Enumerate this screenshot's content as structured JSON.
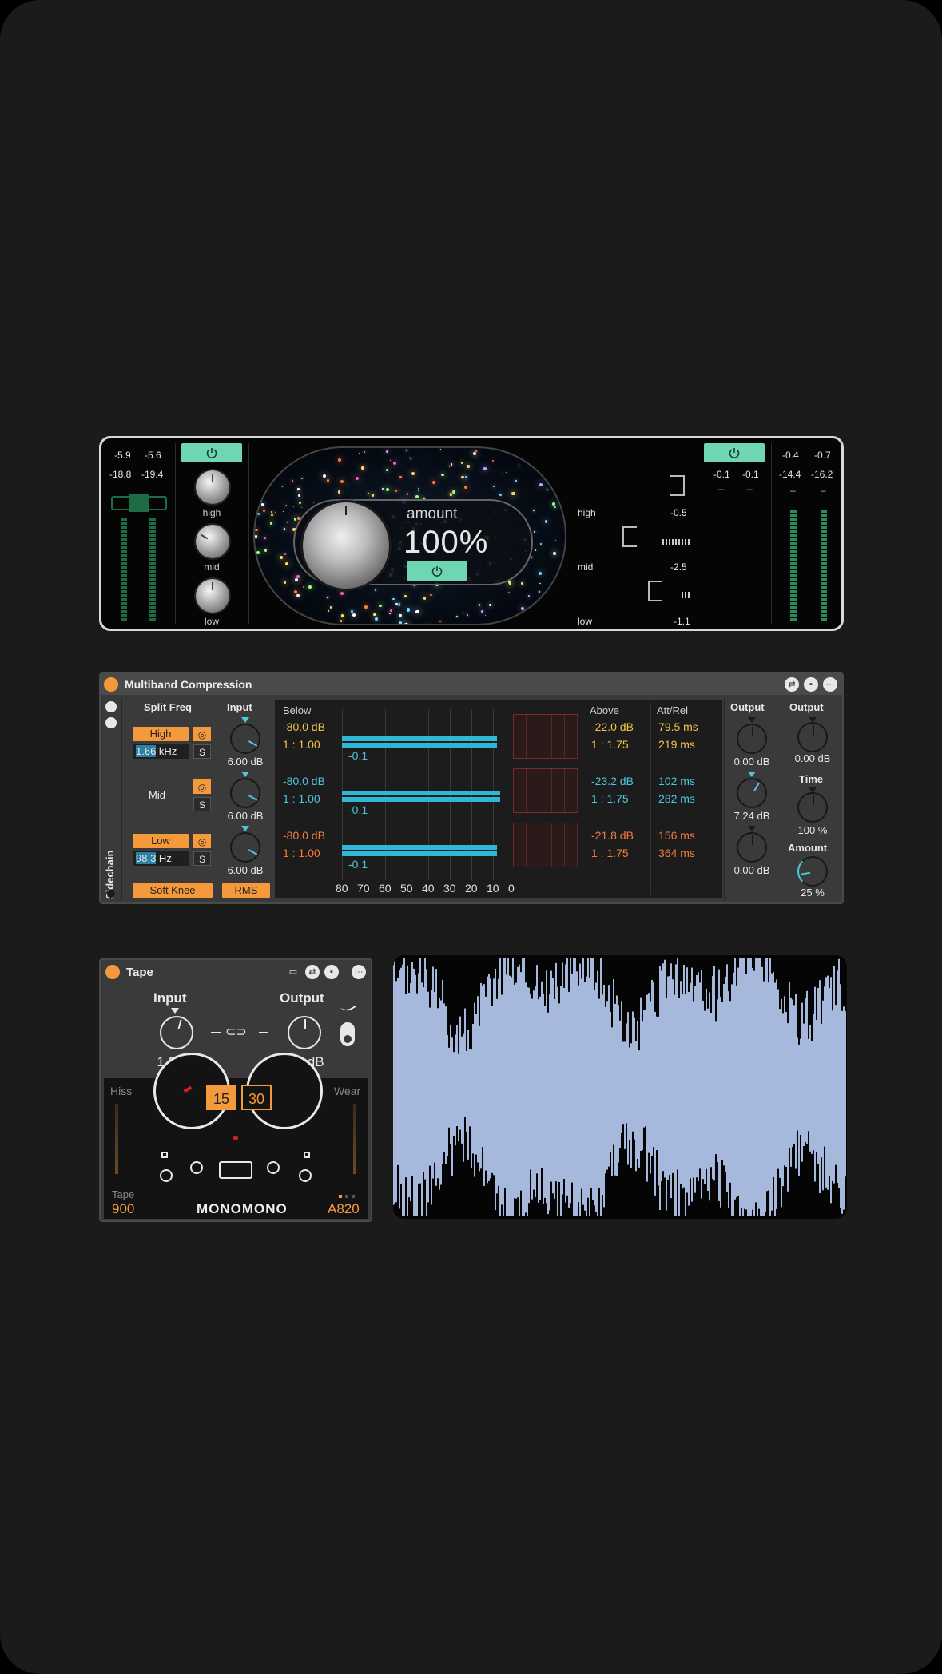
{
  "device1": {
    "left_meter": {
      "peak_l": "-5.9",
      "peak_r": "-5.6",
      "rms_l": "-18.8",
      "rms_r": "-19.4"
    },
    "right_meter": {
      "peak_l": "-0.4",
      "peak_r": "-0.7",
      "rms_l": "-14.4",
      "rms_r": "-16.2"
    },
    "bands": [
      {
        "label": "high"
      },
      {
        "label": "mid"
      },
      {
        "label": "low"
      }
    ],
    "amount_label": "amount",
    "amount_value": "100%",
    "gain_labels": {
      "high": "high",
      "mid": "mid",
      "low": "low"
    },
    "gain_values": {
      "high": "-0.5",
      "mid": "-2.5",
      "low": "-1.1"
    },
    "out_values": {
      "a": "-0.1",
      "b": "-0.1"
    },
    "dash": "–",
    "accent": "#6fd6b3"
  },
  "multiband": {
    "title": "Multiband Compression",
    "split_freq_label": "Split Freq",
    "input_label": "Input",
    "below_label": "Below",
    "above_label": "Above",
    "att_rel_label": "Att/Rel",
    "output_label": "Output",
    "output2_label": "Output",
    "time_label": "Time",
    "amount_label": "Amount",
    "sidechain_label": "Sidechain",
    "high_btn": "High",
    "low_btn": "Low",
    "mid_label": "Mid",
    "solo": "S",
    "high_freq_hl": "1.66",
    "high_freq_unit": " kHz",
    "low_freq_hl": "98.3",
    "low_freq_unit": " Hz",
    "soft_knee": "Soft Knee",
    "rms": "RMS",
    "input_gains": [
      "6.00 dB",
      "6.00 dB",
      "6.00 dB"
    ],
    "output_gains": [
      "0.00 dB",
      "7.24 dB",
      "0.00 dB"
    ],
    "global_output": "0.00 dB",
    "time_value": "100 %",
    "amount_value": "25 %",
    "rows": [
      {
        "below_thr": "-80.0 dB",
        "below_ratio": "1 : 1.00",
        "gr": "-0.1",
        "above_thr": "-22.0 dB",
        "above_ratio": "1 : 1.75",
        "attack": "79.5 ms",
        "release": "219 ms"
      },
      {
        "below_thr": "-80.0 dB",
        "below_ratio": "1 : 1.00",
        "gr": "-0.1",
        "above_thr": "-23.2 dB",
        "above_ratio": "1 : 1.75",
        "attack": "102 ms",
        "release": "282 ms"
      },
      {
        "below_thr": "-80.0 dB",
        "below_ratio": "1 : 1.00",
        "gr": "-0.1",
        "above_thr": "-21.8 dB",
        "above_ratio": "1 : 1.75",
        "attack": "156 ms",
        "release": "364 ms"
      }
    ],
    "axis": [
      "80",
      "70",
      "60",
      "50",
      "40",
      "30",
      "20",
      "10",
      "0"
    ],
    "colors": {
      "high": "#f2c24a",
      "mid": "#4ec6df",
      "low": "#f47b3c",
      "orange": "#f59a3c"
    }
  },
  "tape": {
    "title": "Tape",
    "input_label": "Input",
    "output_label": "Output",
    "input_value": "1.2 dB",
    "output_value": "0.0 dB",
    "link": "⊂⊃",
    "speed_on": "15",
    "speed_off": "30",
    "hiss_label": "Hiss",
    "wear_label": "Wear",
    "tape_label": "Tape",
    "tape_value": "900",
    "brand": "MONOMONO",
    "model": "A820"
  }
}
